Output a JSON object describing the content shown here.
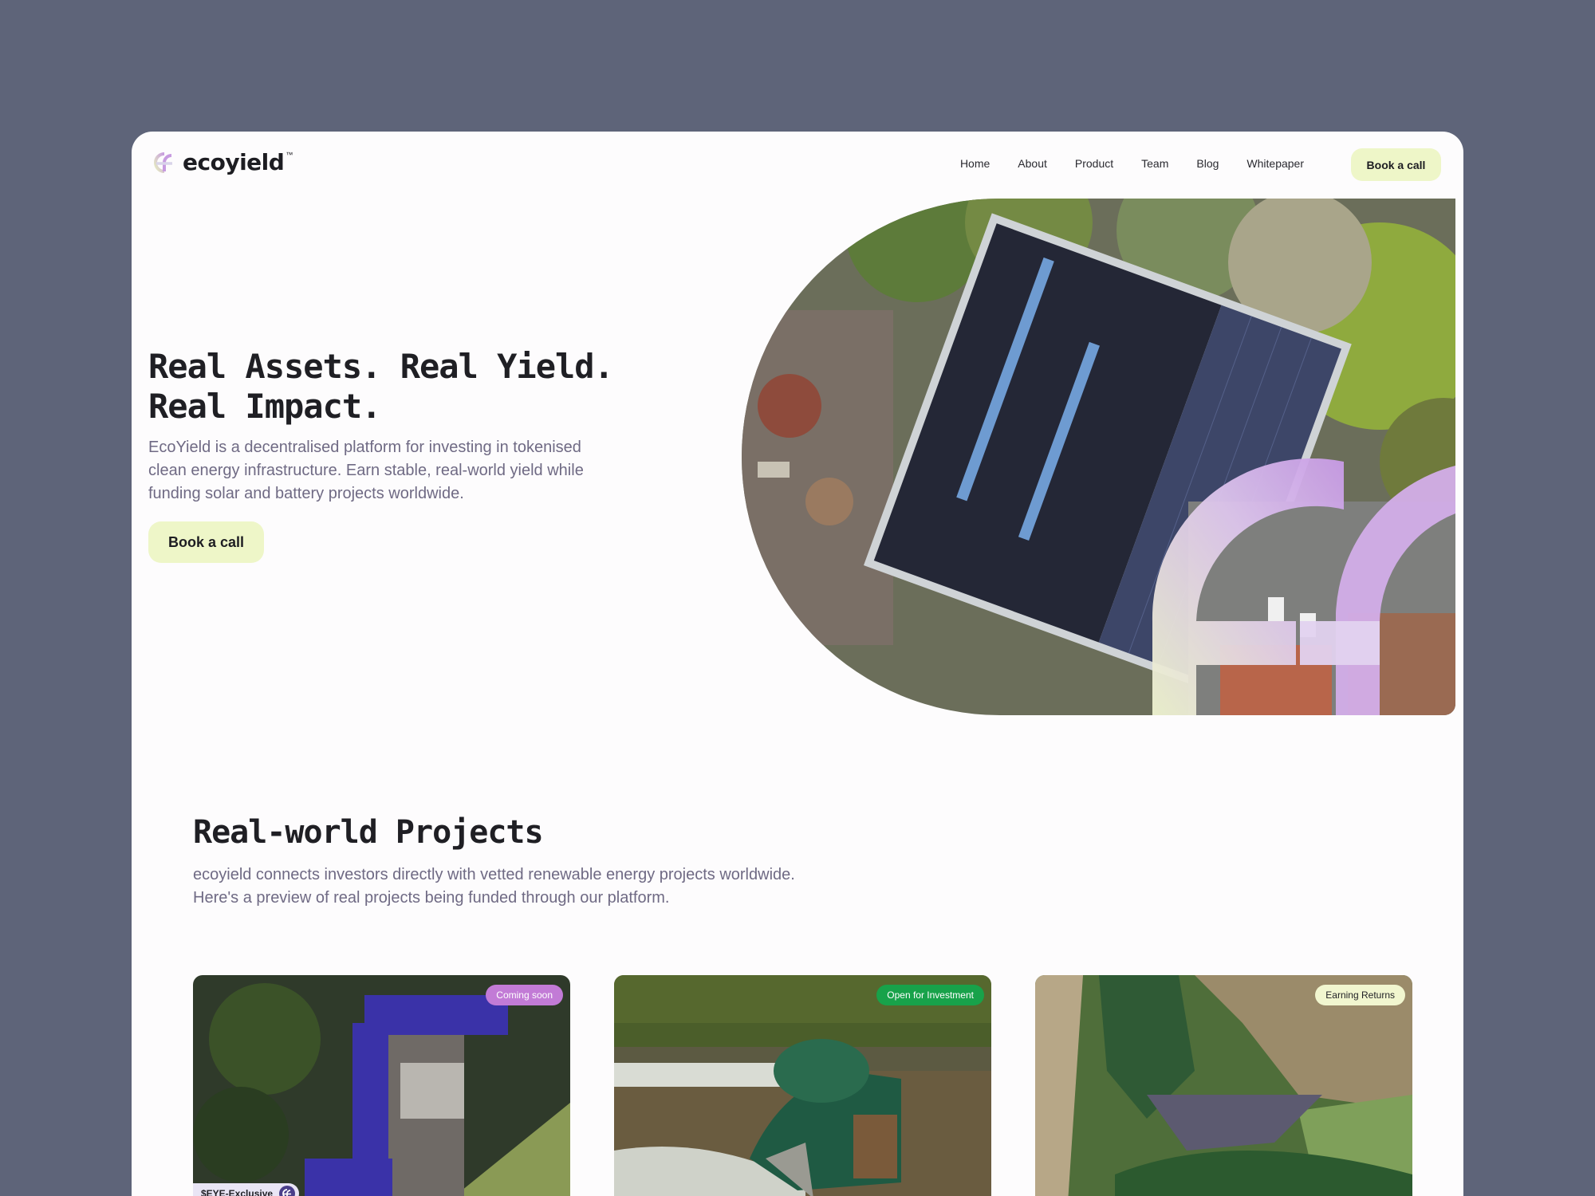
{
  "header": {
    "logo_text": "ecoyield",
    "logo_tm": "™",
    "nav": [
      {
        "label": "Home"
      },
      {
        "label": "About"
      },
      {
        "label": "Product"
      },
      {
        "label": "Team"
      },
      {
        "label": "Blog"
      },
      {
        "label": "Whitepaper"
      }
    ],
    "cta_label": "Book a call"
  },
  "hero": {
    "title": "Real Assets. Real Yield. Real Impact.",
    "description": "EcoYield is a decentralised platform for investing in tokenised clean energy infrastructure. Earn stable, real-world yield while funding solar and battery projects worldwide.",
    "cta_label": "Book a call"
  },
  "projects": {
    "title": "Real-world Projects",
    "description": "ecoyield connects investors directly with vetted renewable energy projects worldwide. Here's a preview of real projects being funded through our platform.",
    "cards": [
      {
        "badge": "Coming soon",
        "tag": "$EYE-Exclusive"
      },
      {
        "badge": "Open for Investment"
      },
      {
        "badge": "Earning Returns"
      }
    ]
  },
  "colors": {
    "page_bg": "#5e6479",
    "cta_bg": "#eef6c8",
    "badge_soon": "#c27bd6",
    "badge_open": "#18a24a",
    "badge_earning": "#f1f6cf",
    "text_muted": "#6f6a84"
  },
  "icons": {
    "logo": "ecoyield-logo-icon",
    "exclusive": "ecoyield-mark-icon"
  }
}
